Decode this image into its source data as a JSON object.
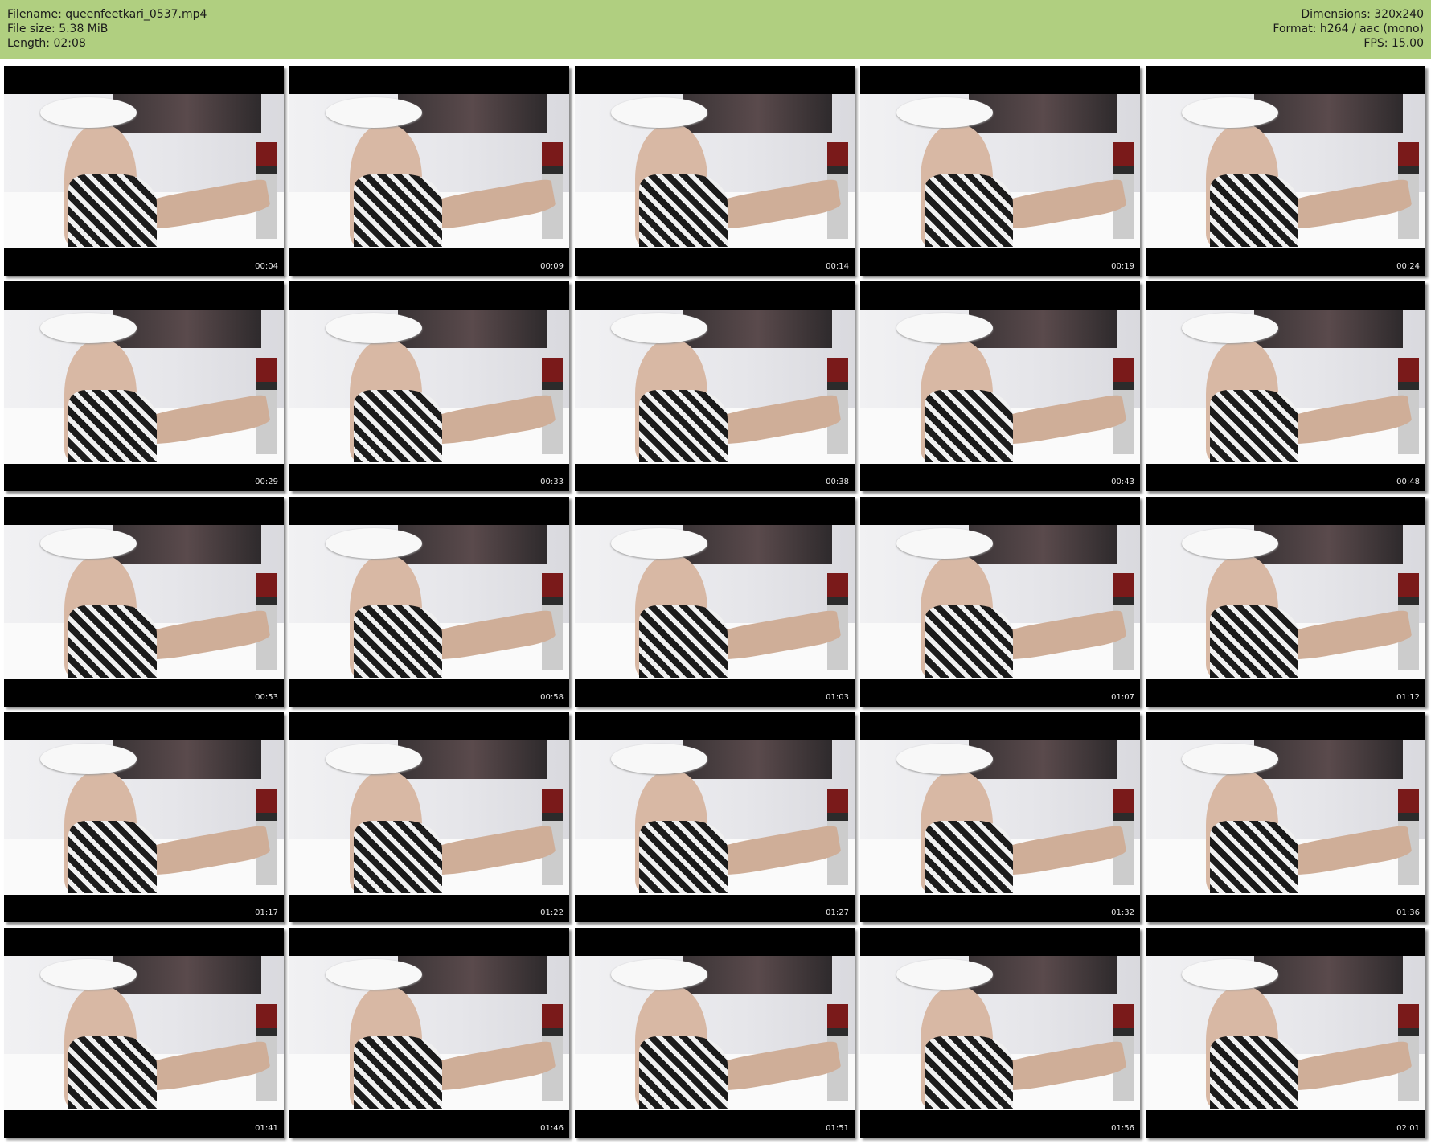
{
  "header": {
    "filename": "Filename: queenfeetkari_0537.mp4",
    "filesize": "File size: 5.38 MiB",
    "length": "Length: 02:08",
    "dimensions": "Dimensions: 320x240",
    "format": "Format: h264 / aac (mono)",
    "fps": "FPS: 15.00"
  },
  "colors": {
    "header_bg": "#b0cf80"
  },
  "thumbnails": [
    "00:04",
    "00:09",
    "00:14",
    "00:19",
    "00:24",
    "00:29",
    "00:33",
    "00:38",
    "00:43",
    "00:48",
    "00:53",
    "00:58",
    "01:03",
    "01:07",
    "01:12",
    "01:17",
    "01:22",
    "01:27",
    "01:32",
    "01:36",
    "01:41",
    "01:46",
    "01:51",
    "01:56",
    "02:01"
  ]
}
